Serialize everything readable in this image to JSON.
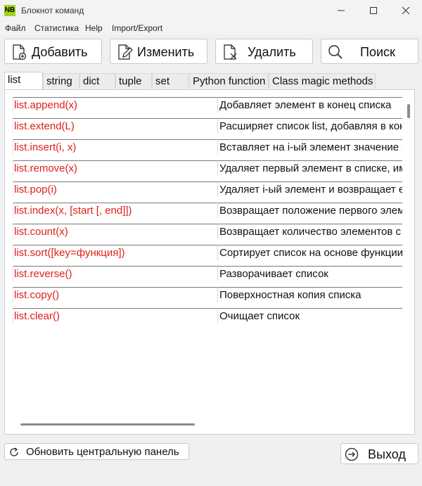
{
  "window": {
    "icon_text": "NB",
    "title": "Блокнот команд"
  },
  "menu": [
    "Файл",
    "Статистика",
    "Help",
    "Import/Export"
  ],
  "toolbar": {
    "add_label": "Добавить",
    "edit_label": "Изменить",
    "delete_label": "Удалить",
    "search_label": "Поиск"
  },
  "tabs": [
    "list",
    "string",
    "dict",
    "tuple",
    "set",
    "Python function",
    "Class magic methods"
  ],
  "active_tab": "list",
  "rows": [
    {
      "command": "list.append(x)",
      "description": "Добавляет элемент в конец списка"
    },
    {
      "command": "list.extend(L)",
      "description": "Расширяет список list, добавляя в кон"
    },
    {
      "command": "list.insert(i, x)",
      "description": "Вставляет на i-ый элемент значение х"
    },
    {
      "command": "list.remove(x)",
      "description": "Удаляет первый элемент в списке, им"
    },
    {
      "command": "list.pop(i)",
      "description": "Удаляет i-ый элемент и возвращает е"
    },
    {
      "command": "list.index(x, [start [, end]])",
      "description": "Возвращает положение первого элем"
    },
    {
      "command": "list.count(x)",
      "description": "Возвращает количество элементов с"
    },
    {
      "command": "list.sort([key=функция])",
      "description": "Сортирует список на основе функции"
    },
    {
      "command": "list.reverse()",
      "description": "Разворачивает список"
    },
    {
      "command": "list.copy()",
      "description": "Поверхностная копия списка"
    },
    {
      "command": "list.clear()",
      "description": "Очищает список"
    }
  ],
  "bottom": {
    "refresh_label": "Обновить центральную панель",
    "exit_label": "Выход"
  },
  "colors": {
    "command_text": "#e0201a",
    "icon_bg": "#a3d11d"
  }
}
